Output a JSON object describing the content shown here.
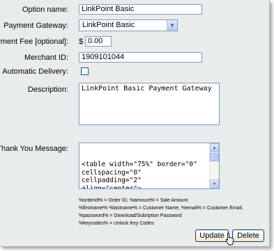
{
  "form": {
    "option_name": {
      "label": "Option name:",
      "value": "LinkPoint Basic"
    },
    "payment_gateway": {
      "label": "Payment Gateway:",
      "selected": "LinkPoint Basic"
    },
    "payment_fee": {
      "label": "Payment Fee [optional]:",
      "currency": "$",
      "value": "0.00"
    },
    "merchant_id": {
      "label": "Merchant ID:",
      "value": "1909101044"
    },
    "automatic_delivery": {
      "label": "Automatic Delivery:",
      "checked": false
    },
    "description": {
      "label": "Description:",
      "value": "LinkPoint Basic Payment Gateway"
    },
    "thank_you": {
      "label": "Thank You Message:",
      "value": "<table width=\"75%\" border=\"0\"\ncellspacing=\"0\"\ncellpadding=\"2\"\nalign=\"center\">\n  <tr align=\"center\">"
    },
    "legend": "%orderid% = Order ID, %amount% = Sale Amount\n%firstname% %lastname% = Customer Name, %email% = Customer Email,\n%password% = Download/Subription Password\n%keycodes% = Unlock Key Codes"
  },
  "buttons": {
    "update": "Update",
    "delete": "Delete"
  },
  "icons": {
    "dropdown": "chevron-down-icon",
    "cursor": "pointer-cursor-icon"
  }
}
